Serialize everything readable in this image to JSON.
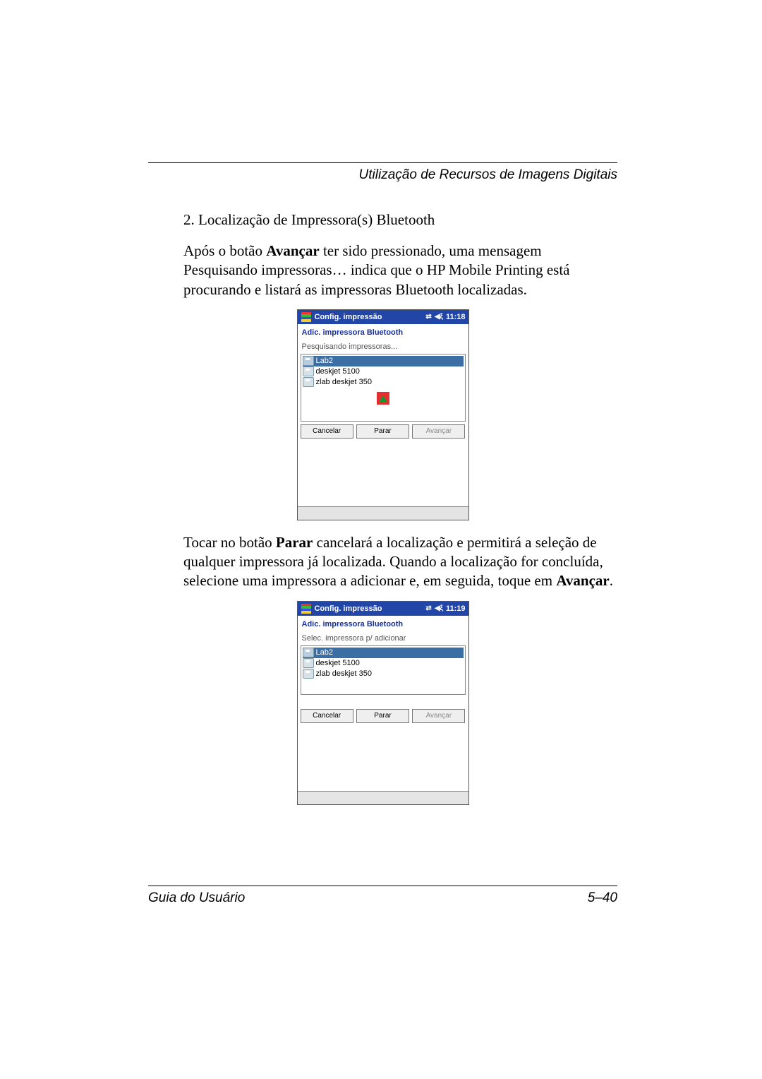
{
  "header": {
    "chapter_title": "Utilização de Recursos de Imagens Digitais"
  },
  "step": {
    "number": "2.",
    "text": "Localização de Impressora(s) Bluetooth"
  },
  "para1": {
    "pre": "Após o botão ",
    "bold": "Avançar",
    "post": " ter sido pressionado, uma mensagem Pesquisando impressoras… indica que o HP Mobile Printing está procurando e listará as impressoras Bluetooth localizadas."
  },
  "para2": {
    "pre": "Tocar no botão ",
    "bold1": "Parar",
    "mid": " cancelará a localização e permitirá a seleção de qualquer impressora já localizada. Quando a localização for concluída, selecione uma impressora a adicionar e, em seguida, toque em ",
    "bold2": "Avançar",
    "post": "."
  },
  "screen1": {
    "title": "Config. impressão",
    "time": "11:18",
    "subtitle": "Adic. impressora Bluetooth",
    "instruction": "Pesquisando impressoras...",
    "items": [
      "Lab2",
      "deskjet 5100",
      "zlab deskjet 350"
    ],
    "selectedIndex": 0,
    "buttons": {
      "cancel": "Cancelar",
      "stop": "Parar",
      "next": "Avançar"
    }
  },
  "screen2": {
    "title": "Config. impressão",
    "time": "11:19",
    "subtitle": "Adic. impressora Bluetooth",
    "instruction": "Selec. impressora p/ adicionar",
    "items": [
      "Lab2",
      "deskjet 5100",
      "zlab deskjet 350"
    ],
    "selectedIndex": 0,
    "buttons": {
      "cancel": "Cancelar",
      "stop": "Parar",
      "next": "Avançar"
    }
  },
  "footer": {
    "left": "Guia do Usuário",
    "right": "5–40"
  }
}
